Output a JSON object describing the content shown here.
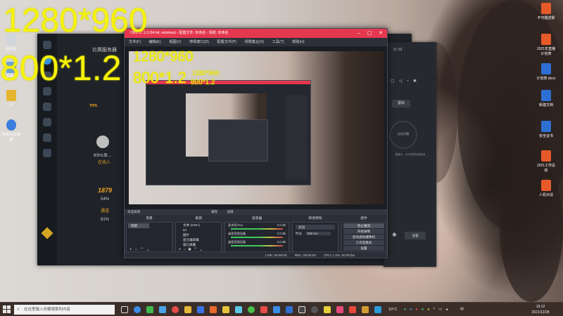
{
  "overlay": {
    "line1": "1280*960",
    "line2": "800*1.2"
  },
  "nested1": {
    "line1": "1280*960",
    "line2": "800*1.2"
  },
  "nested2": {
    "line1": "1280*960",
    "line2": "800*1.2"
  },
  "obs": {
    "title": "OBS 27.1.3 (64-bit, windows) - 配置文件: 未命名 - 场景: 未命名",
    "menu": [
      "文件(F)",
      "编辑(E)",
      "视图(V)",
      "停靠窗口(D)",
      "配置文件(P)",
      "场景集合(S)",
      "工具(T)",
      "帮助(H)"
    ],
    "source_bar_label": "未选择源",
    "source_bar_props": "属性",
    "source_bar_filters": "滤镜",
    "docks": {
      "scenes": {
        "title": "场景",
        "items": [
          "场景"
        ]
      },
      "sources": {
        "title": "来源",
        "items": [
          "文本 (GDI+)",
          "txt",
          "图片",
          "显示器采集",
          "窗口采集"
        ]
      },
      "mixer": {
        "title": "混音器",
        "channels": [
          {
            "name": "麦克风/Aux",
            "db": "0.0 dB"
          },
          {
            "name": "桌面音频设备",
            "db": "0.0 dB"
          },
          {
            "name": "桌面音频设备",
            "db": "0.0 dB"
          }
        ]
      },
      "transitions": {
        "title": "转场特效",
        "type": "淡出",
        "duration_label": "时长",
        "duration": "300 ms"
      },
      "controls": {
        "title": "控件",
        "buttons": [
          "停止推流",
          "开始录制",
          "启动虚拟摄像机",
          "工作室模式",
          "设置",
          "退出"
        ]
      }
    },
    "status": {
      "live": "LIVE: 00:00:00",
      "rec": "REC: 00:00:00",
      "cpu": "CPU: 1.2%, 60.00 fps"
    }
  },
  "bgapp": {
    "header": "比赛服务器",
    "tips": "TIPS",
    "number": "1879",
    "stats": [
      "54%",
      "通道",
      "61%"
    ],
    "user_label": "60Hz显...",
    "status_text": "在线人"
  },
  "rpanel": {
    "counter": "3 / 31",
    "out_button": "退出",
    "auto_label": "自动开播",
    "small_text": "直播中，点击查看详细信息",
    "btn": "设置"
  },
  "desktop_icons": [
    {
      "label": "回收站"
    },
    {
      "label": "此电脑"
    },
    {
      "label": "yy"
    },
    {
      "label": "网易UU加速器"
    }
  ],
  "desktop_right_icons": [
    {
      "label": "不可描述报"
    },
    {
      "label": "2021年直播计划表"
    },
    {
      "label": "计划表.docx"
    },
    {
      "label": "新建文档"
    },
    {
      "label": "安全证书"
    },
    {
      "label": "2021工作总结"
    },
    {
      "label": "人机对话"
    }
  ],
  "taskbar": {
    "search_placeholder": "在这里输入你要搜索的内容",
    "temperature": "10°C",
    "ime": "中",
    "time": "19:12",
    "date": "2021/12/28"
  },
  "colors": {
    "obs_titlebar": "#e4384f",
    "overlay_text": "#f6f30a"
  }
}
